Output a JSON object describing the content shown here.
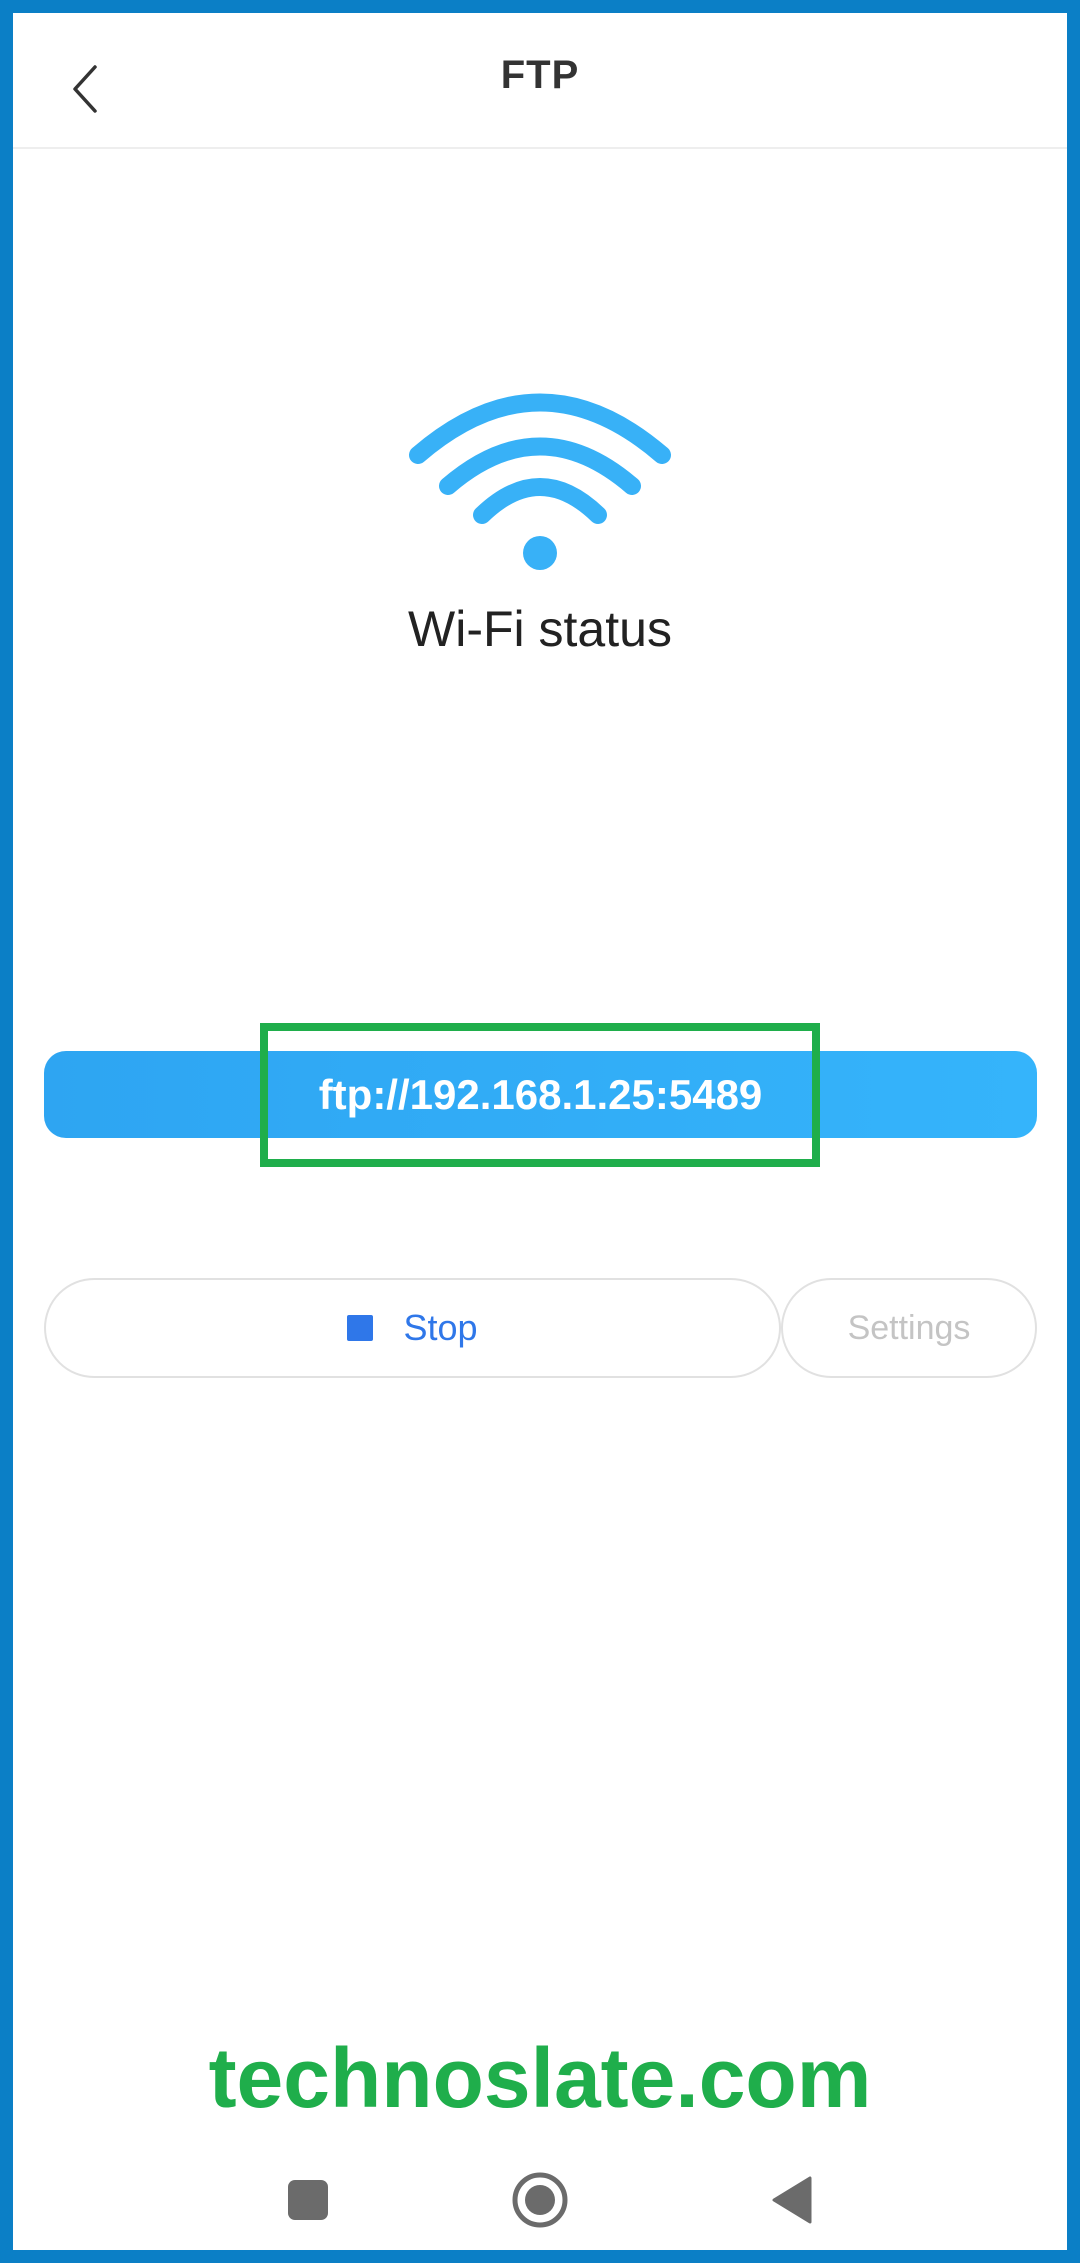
{
  "header": {
    "title": "FTP",
    "back_icon": "chevron-left-icon"
  },
  "status": {
    "icon": "wifi-icon",
    "label": "Wi-Fi status",
    "icon_color": "#38b1f7"
  },
  "server": {
    "url": "ftp://192.168.1.25:5489",
    "bar_color": "#35b4fb"
  },
  "actions": {
    "stop": {
      "label": "Stop",
      "icon": "stop-square-icon",
      "color": "#2f77e9"
    },
    "settings": {
      "label": "Settings",
      "enabled": false
    }
  },
  "watermark": {
    "text": "technoslate.com",
    "color": "#1fae4b"
  },
  "navigation": {
    "recents_icon": "square-icon",
    "home_icon": "circle-home-icon",
    "back_icon": "triangle-back-icon"
  },
  "highlight_color": "#1fae4b",
  "frame_color": "#0b7fc6"
}
